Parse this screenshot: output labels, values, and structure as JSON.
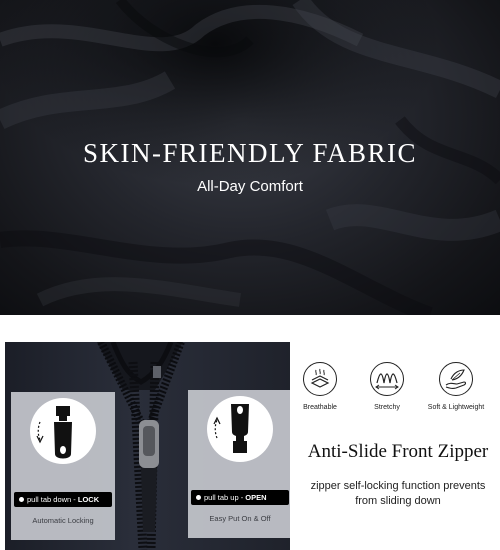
{
  "hero": {
    "title": "SKIN-FRIENDLY FABRIC",
    "subtitle": "All-Day Comfort"
  },
  "zipper": {
    "lock": {
      "action": "pull tab down - ",
      "state": "LOCK",
      "caption": "Automatic Locking",
      "icon": "zipper-tab-down-icon"
    },
    "open": {
      "action": "pull tab up - ",
      "state": "OPEN",
      "caption": "Easy Put On & Off",
      "icon": "zipper-tab-up-icon"
    }
  },
  "features": [
    {
      "label": "Breathable",
      "icon": "breathable-layers-icon"
    },
    {
      "label": "Stretchy",
      "icon": "stretch-wave-icon"
    },
    {
      "label": "Soft & Lightweight",
      "icon": "feather-hand-icon"
    }
  ],
  "section": {
    "title": "Anti-Slide Front Zipper",
    "description_line1": "zipper self-locking function prevents",
    "description_line2": "from sliding down"
  },
  "colors": {
    "fabric": "#1c1d22",
    "card": "#c4c6cc",
    "text_dark": "#111111",
    "white": "#ffffff"
  }
}
